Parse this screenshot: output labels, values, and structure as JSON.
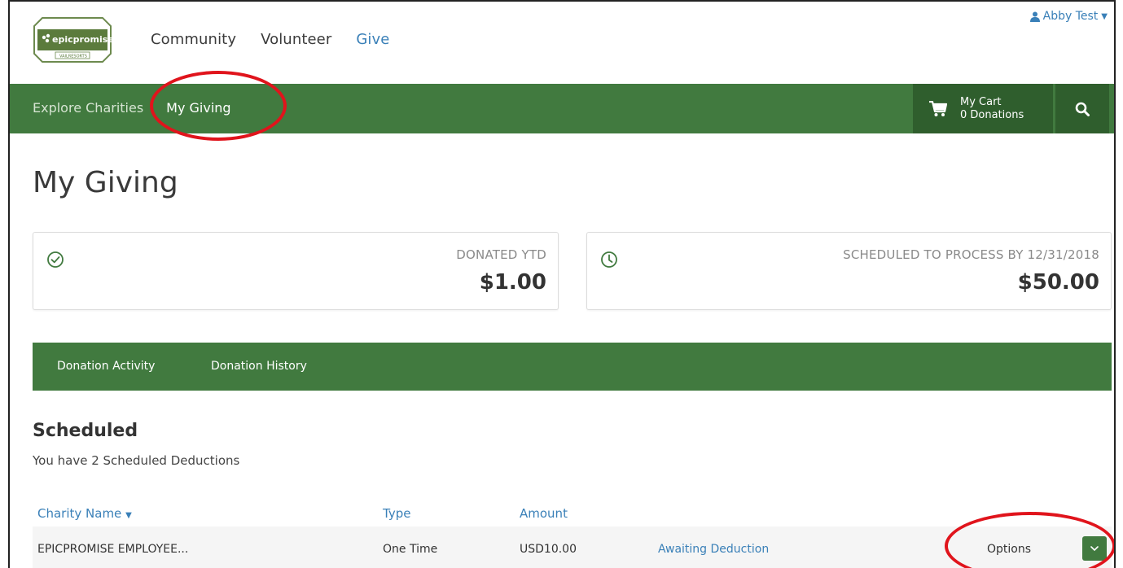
{
  "header": {
    "logo_text": "epicpromise",
    "logo_subtext": "VAILRESORTS",
    "nav": [
      "Community",
      "Volunteer",
      "Give"
    ],
    "active_nav": "Give",
    "user_name": "Abby Test"
  },
  "subnav": {
    "items": [
      "Explore Charities",
      "My Giving"
    ],
    "active": "My Giving",
    "cart_title": "My Cart",
    "cart_count": "0 Donations"
  },
  "page": {
    "title": "My Giving"
  },
  "stats": {
    "donated_label": "DONATED YTD",
    "donated_value": "$1.00",
    "scheduled_label": "SCHEDULED TO PROCESS BY 12/31/2018",
    "scheduled_value": "$50.00"
  },
  "tabs": [
    "Donation Activity",
    "Donation History"
  ],
  "scheduled": {
    "title": "Scheduled",
    "subtitle": "You have 2 Scheduled Deductions",
    "columns": {
      "charity": "Charity Name",
      "type": "Type",
      "amount": "Amount"
    },
    "rows": [
      {
        "charity": "EPICPROMISE EMPLOYEE...",
        "type": "One Time",
        "amount": "USD10.00",
        "status": "Awaiting Deduction",
        "options": "Options"
      }
    ]
  },
  "colors": {
    "brand_green": "#417a3f",
    "dark_green": "#2f5e2d",
    "link_blue": "#3a80b8",
    "annotation_red": "#e0141c"
  }
}
